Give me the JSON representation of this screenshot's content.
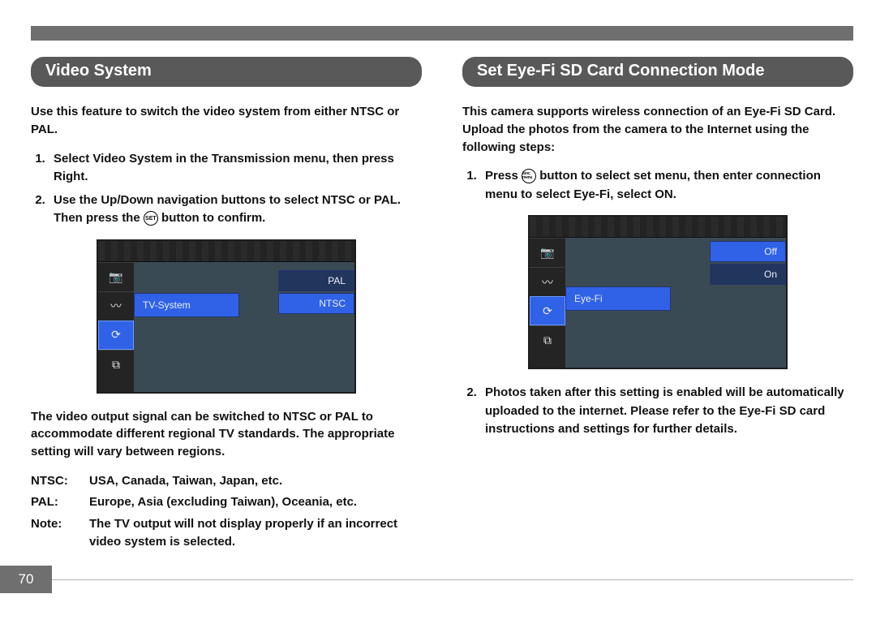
{
  "page_number": "70",
  "left": {
    "heading": "Video System",
    "intro": "Use this feature to switch the video system from either NTSC or PAL.",
    "steps": [
      "Select Video System in the Transmission menu, then press Right.",
      {
        "pre": "Use the Up/Down navigation buttons to select NTSC or PAL. Then press the ",
        "icon": "SET",
        "post": " button to confirm."
      }
    ],
    "screenshot": {
      "sidebar_active_index": 2,
      "menu_label": "TV-System",
      "options": [
        "PAL",
        "NTSC"
      ],
      "selected_option_index": 1
    },
    "after": "The video output signal can be switched to NTSC or PAL to accommodate different regional TV standards. The appropriate setting will vary between regions.",
    "defs": [
      {
        "label": "NTSC:",
        "value": "USA, Canada, Taiwan, Japan, etc."
      },
      {
        "label": "PAL:",
        "value": "Europe, Asia (excluding Taiwan), Oceania, etc."
      },
      {
        "label": "Note:",
        "value": "The TV output will not display properly if an incorrect video system is selected."
      }
    ]
  },
  "right": {
    "heading": "Set Eye-Fi SD Card Connection Mode",
    "intro": "This camera supports wireless connection of an Eye-Fi SD Card. Upload the photos from the camera to the Internet using the following steps:",
    "steps": [
      {
        "pre": "Press ",
        "icon": "func menu",
        "post": " button to select set menu, then enter connection menu to select Eye-Fi, select ON."
      }
    ],
    "screenshot": {
      "sidebar_active_index": 2,
      "menu_label": "Eye-Fi",
      "options": [
        "Off",
        "On"
      ],
      "selected_option_index": 0
    },
    "step2": "Photos taken after this setting is enabled will be automatically uploaded to the internet. Please refer to the Eye-Fi SD card instructions and settings for further details."
  },
  "icons": {
    "camera": "📷",
    "wrench": "〰",
    "refresh": "⟳",
    "screens": "⧉"
  }
}
